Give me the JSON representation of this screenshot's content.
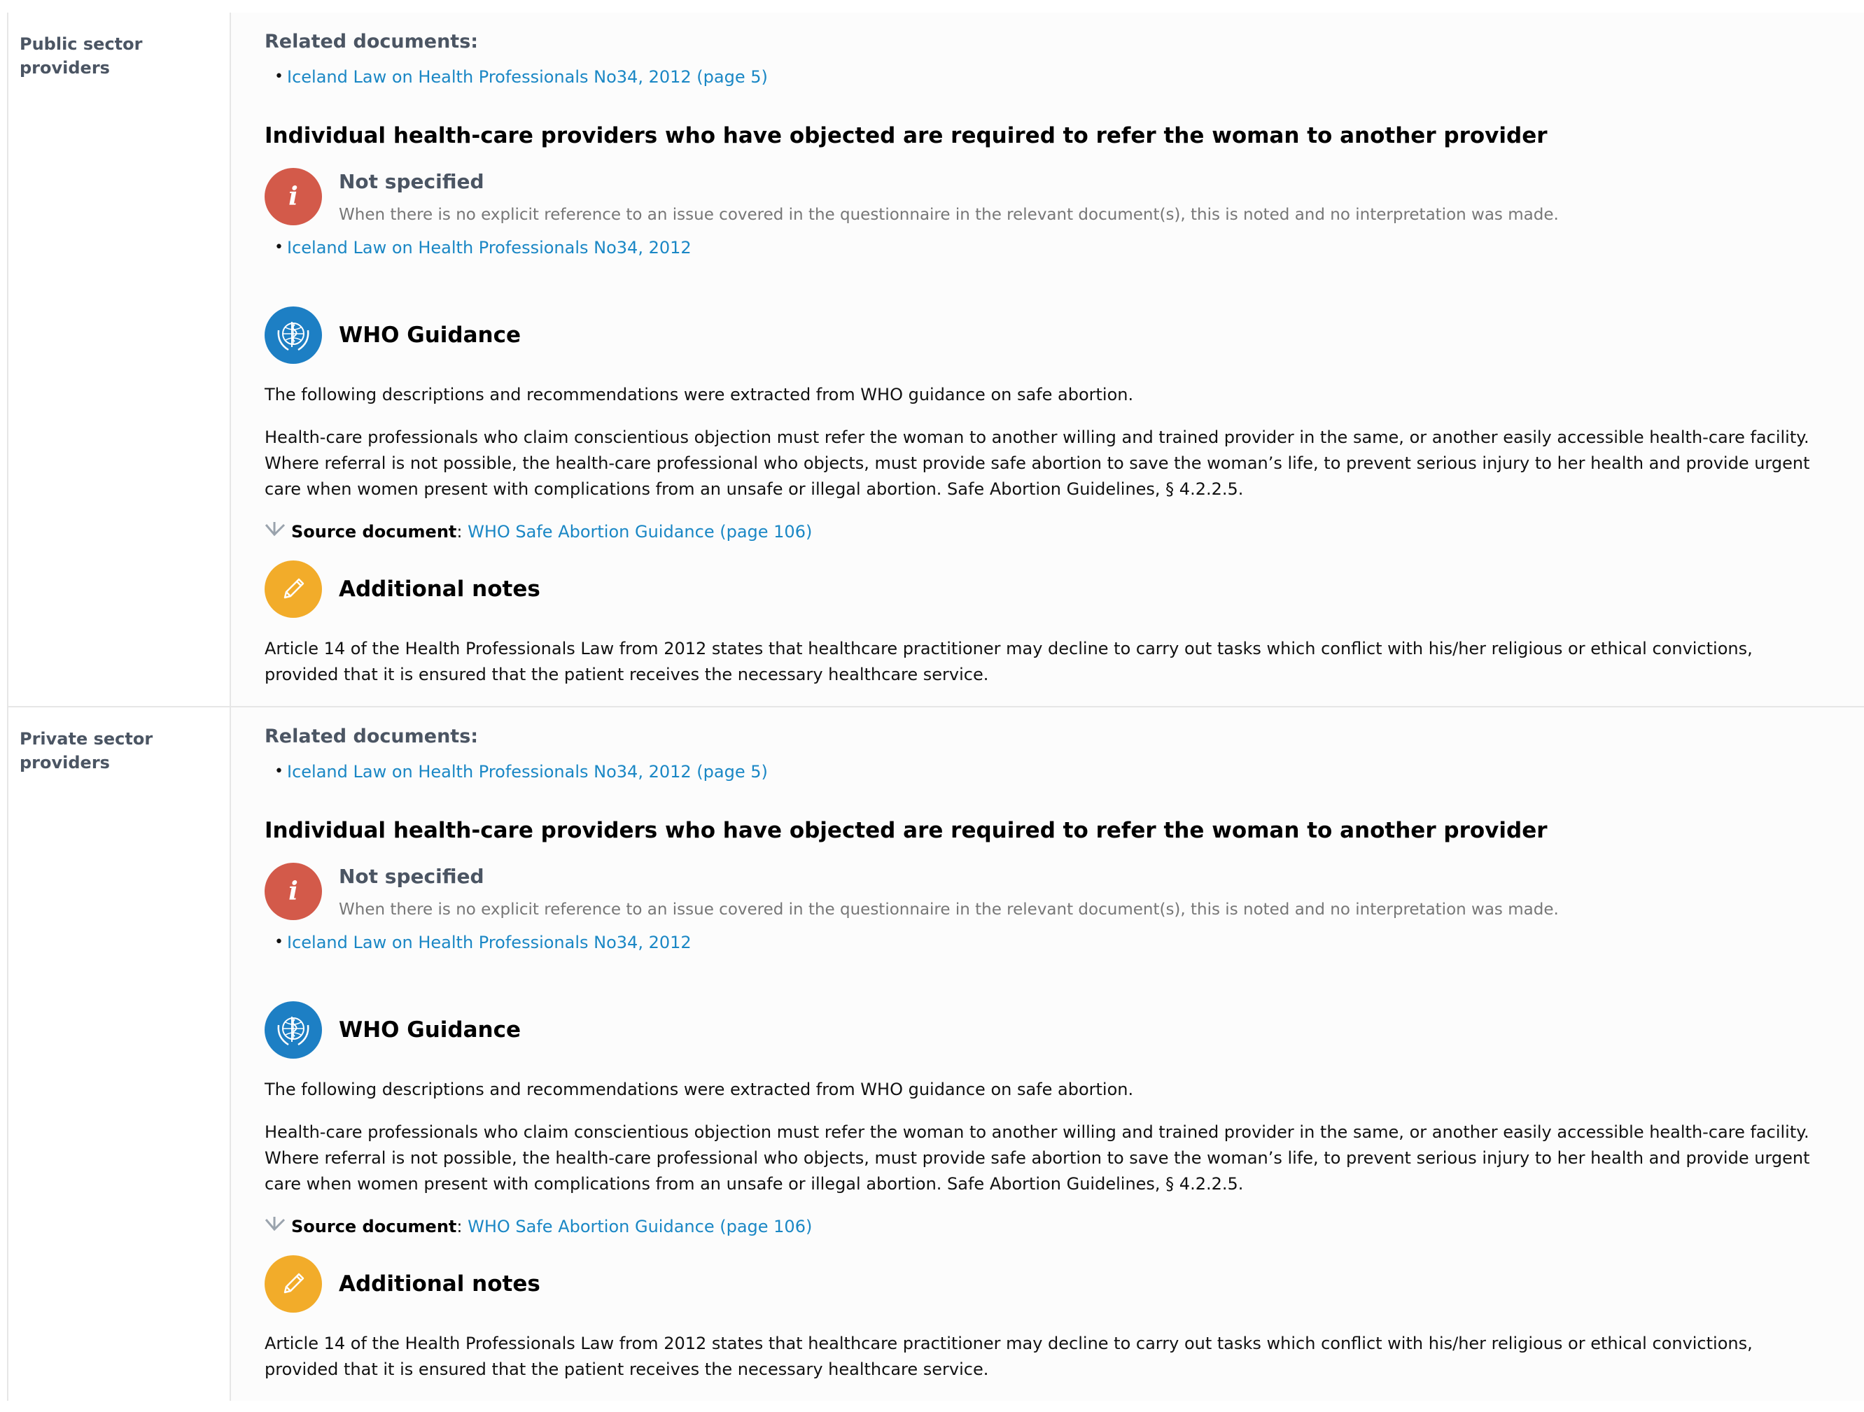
{
  "rows": [
    {
      "label": "Public sector providers",
      "related_title": "Related documents:",
      "related_docs": [
        "Iceland Law on Health Professionals No34, 2012 (page 5)"
      ],
      "question": "Individual health-care providers who have objected are required to refer the woman to another provider",
      "status_title": "Not specified",
      "status_desc": "When there is no explicit reference to an issue covered in the questionnaire in the relevant document(s), this is noted and no interpretation was made.",
      "status_docs": [
        "Iceland Law on Health Professionals No34, 2012"
      ],
      "who_title": "WHO Guidance",
      "who_intro": "The following descriptions and recommendations were extracted from WHO guidance on safe abortion.",
      "who_text": "Health-care professionals who claim conscientious objection must refer the woman to another willing and trained provider in the same, or another easily accessible health-care facility. Where referral is not possible, the health-care professional who objects, must provide safe abortion to save the woman’s life, to prevent serious injury to her health and provide urgent care when women present with complications from an unsafe or illegal abortion. Safe Abortion Guidelines, § 4.2.2.5.",
      "source_label": "Source document",
      "source_link": "WHO Safe Abortion Guidance (page 106)",
      "notes_title": "Additional notes",
      "notes_text": "Article 14 of the Health Professionals Law from 2012 states that healthcare practitioner may decline to carry out tasks which conflict with his/her religious or ethical convictions, provided that it is ensured that the patient receives the necessary healthcare service."
    },
    {
      "label": "Private sector providers",
      "related_title": "Related documents:",
      "related_docs": [
        "Iceland Law on Health Professionals No34, 2012 (page 5)"
      ],
      "question": "Individual health-care providers who have objected are required to refer the woman to another provider",
      "status_title": "Not specified",
      "status_desc": "When there is no explicit reference to an issue covered in the questionnaire in the relevant document(s), this is noted and no interpretation was made.",
      "status_docs": [
        "Iceland Law on Health Professionals No34, 2012"
      ],
      "who_title": "WHO Guidance",
      "who_intro": "The following descriptions and recommendations were extracted from WHO guidance on safe abortion.",
      "who_text": "Health-care professionals who claim conscientious objection must refer the woman to another willing and trained provider in the same, or another easily accessible health-care facility. Where referral is not possible, the health-care professional who objects, must provide safe abortion to save the woman’s life, to prevent serious injury to her health and provide urgent care when women present with complications from an unsafe or illegal abortion. Safe Abortion Guidelines, § 4.2.2.5.",
      "source_label": "Source document",
      "source_link": "WHO Safe Abortion Guidance (page 106)",
      "notes_title": "Additional notes",
      "notes_text": "Article 14 of the Health Professionals Law from 2012 states that healthcare practitioner may decline to carry out tasks which conflict with his/her religious or ethical convictions, provided that it is ensured that the patient receives the necessary healthcare service."
    }
  ],
  "icons": {
    "status": "info-icon",
    "who": "who-emblem-icon",
    "notes": "pencil-icon",
    "source": "arrow-down-icon"
  },
  "colors": {
    "link": "#1a87c5",
    "info": "#d35a4a",
    "who": "#1d7fc4",
    "notes": "#f2ac2a"
  }
}
